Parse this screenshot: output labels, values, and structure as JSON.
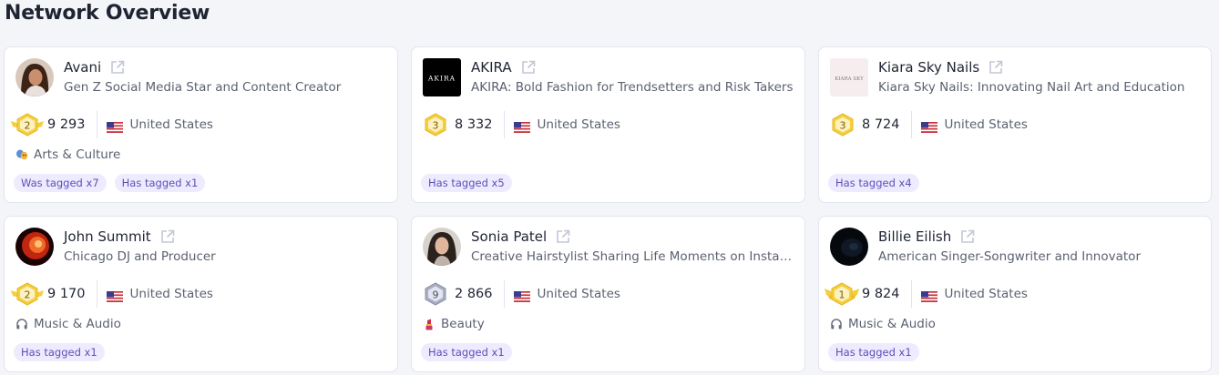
{
  "page": {
    "title": "Network Overview"
  },
  "cards": [
    {
      "name": "Avani",
      "description": "Gen Z Social Media Star and Content Creator",
      "rank": "2",
      "score": "9 293",
      "country": "United States",
      "category": "Arts & Culture",
      "tags": [
        "Was tagged x7",
        "Has tagged x1"
      ]
    },
    {
      "name": "AKIRA",
      "logo_text": "AKIRA",
      "description": "AKIRA: Bold Fashion for Trendsetters and Risk Takers",
      "rank": "3",
      "score": "8 332",
      "country": "United States",
      "category": "",
      "tags": [
        "Has tagged x5"
      ]
    },
    {
      "name": "Kiara Sky Nails",
      "logo_text": "KIARA SKY",
      "description": "Kiara Sky Nails: Innovating Nail Art and Education",
      "rank": "3",
      "score": "8 724",
      "country": "United States",
      "category": "",
      "tags": [
        "Has tagged x4"
      ]
    },
    {
      "name": "John Summit",
      "description": "Chicago DJ and Producer",
      "rank": "2",
      "score": "9 170",
      "country": "United States",
      "category": "Music & Audio",
      "tags": [
        "Has tagged x1"
      ]
    },
    {
      "name": "Sonia Patel",
      "description": "Creative Hairstylist Sharing Life Moments on Instagram",
      "rank": "9",
      "score": "2 866",
      "country": "United States",
      "category": "Beauty",
      "tags": [
        "Has tagged x1"
      ]
    },
    {
      "name": "Billie Eilish",
      "description": "American Singer-Songwriter and Innovator",
      "rank": "1",
      "score": "9 824",
      "country": "United States",
      "category": "Music & Audio",
      "tags": [
        "Has tagged x1"
      ]
    }
  ],
  "colors": {
    "gold_badge": "#f5cf3f",
    "silver_badge": "#a9adc4",
    "tag_bg": "#eeebff",
    "tag_text": "#5a50b8"
  }
}
